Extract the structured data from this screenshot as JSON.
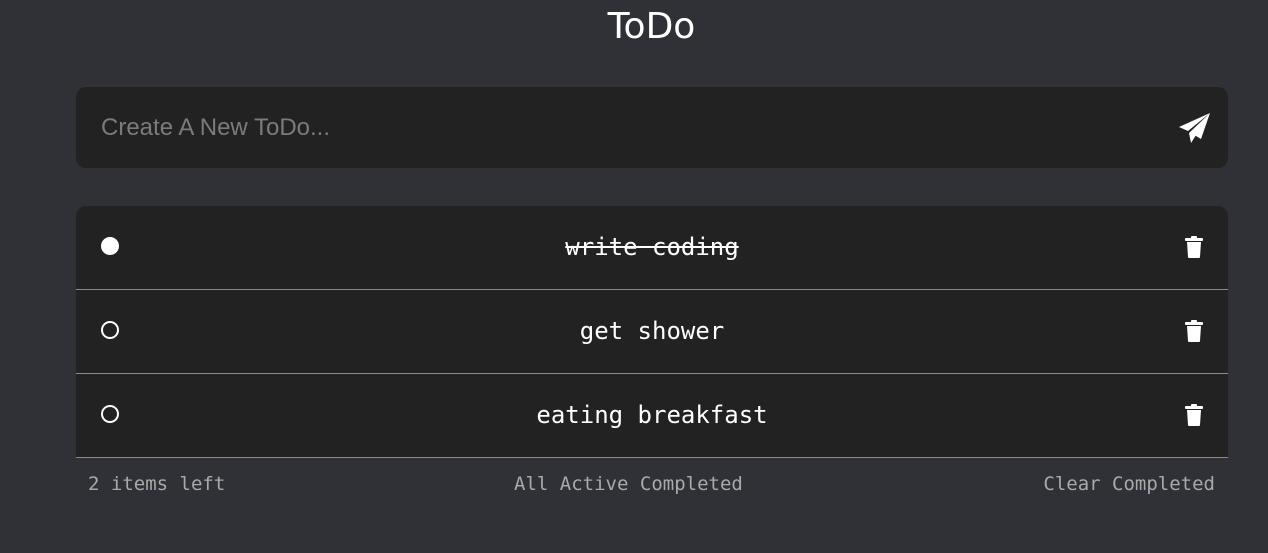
{
  "header": {
    "title": "ToDo"
  },
  "new_todo": {
    "placeholder": "Create A New ToDo...",
    "value": "",
    "submit_icon": "paper-plane-icon"
  },
  "todos": [
    {
      "text": "write coding",
      "completed": true
    },
    {
      "text": "get shower",
      "completed": false
    },
    {
      "text": "eating breakfast",
      "completed": false
    }
  ],
  "footer": {
    "items_left": "2 items left",
    "filters": [
      "All",
      "Active",
      "Completed"
    ],
    "clear_completed": "Clear Completed"
  },
  "colors": {
    "background": "#303136",
    "panel": "#222222",
    "text": "#ffffff",
    "muted_text": "#a9a9a9",
    "placeholder": "#7b7b7b",
    "divider": "#8a8a8a"
  },
  "icons": {
    "delete": "trash-icon",
    "toggle_done": "filled-circle-icon",
    "toggle_open": "empty-circle-icon"
  }
}
